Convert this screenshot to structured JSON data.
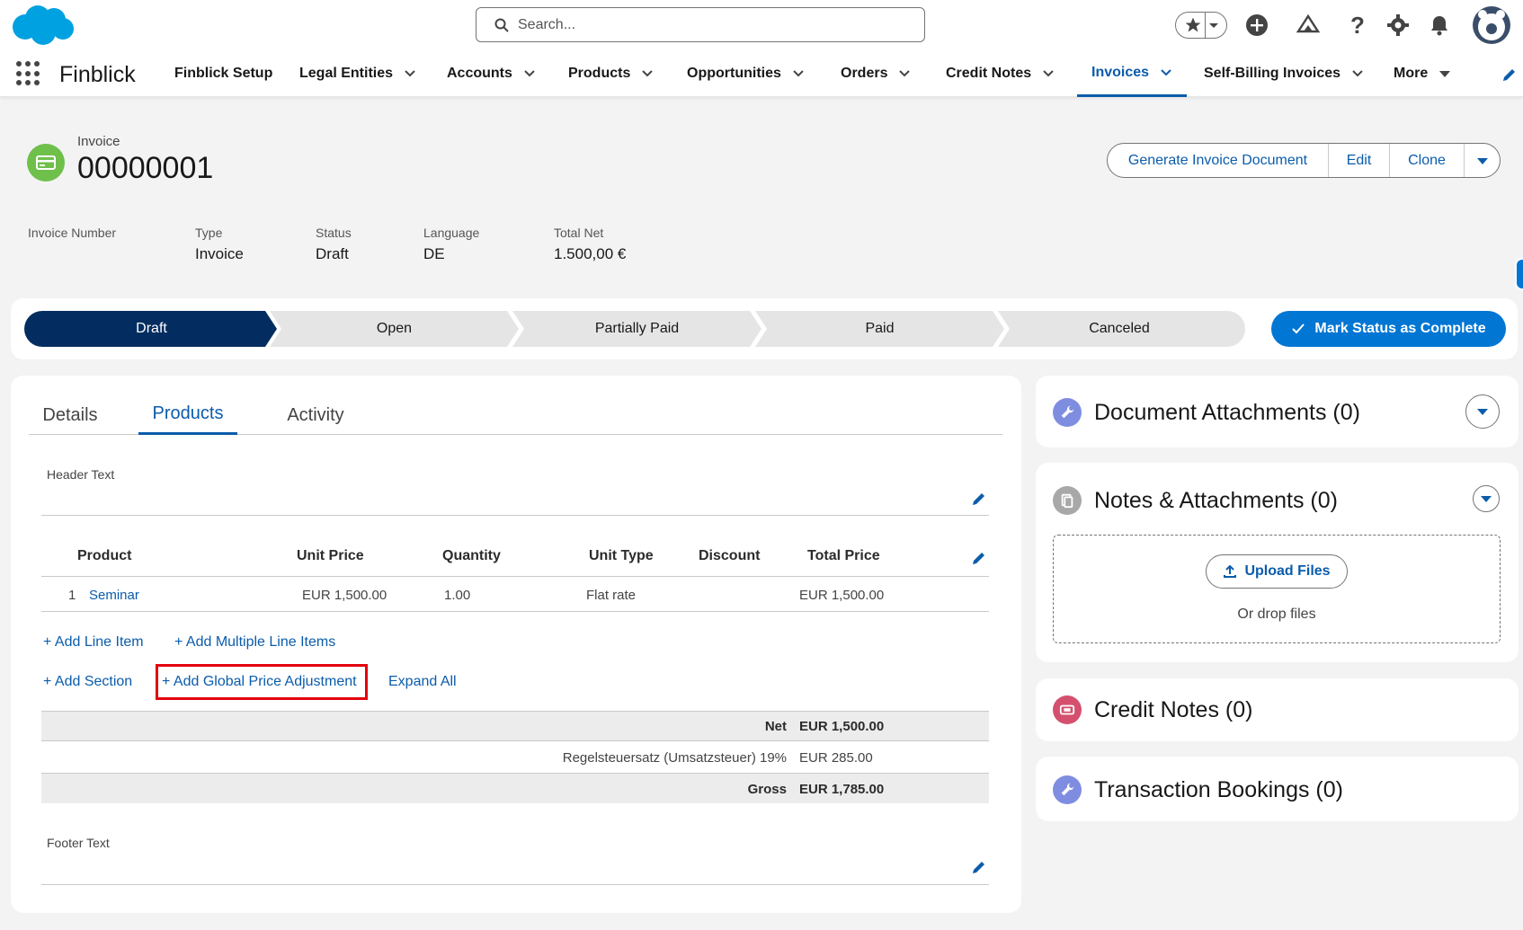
{
  "global": {
    "search_placeholder": "Search...",
    "app_name": "Finblick",
    "icons": [
      "cloud-logo-icon",
      "star-icon",
      "chevron-down-icon",
      "plus-icon",
      "trailhead-icon",
      "help-icon",
      "gear-icon",
      "bell-icon",
      "avatar-icon",
      "app-launcher-icon",
      "edit-nav-icon"
    ]
  },
  "nav": {
    "items": [
      {
        "label": "Finblick Setup",
        "has_menu": false,
        "active": false
      },
      {
        "label": "Legal Entities",
        "has_menu": true,
        "active": false
      },
      {
        "label": "Accounts",
        "has_menu": true,
        "active": false
      },
      {
        "label": "Products",
        "has_menu": true,
        "active": false
      },
      {
        "label": "Opportunities",
        "has_menu": true,
        "active": false
      },
      {
        "label": "Orders",
        "has_menu": true,
        "active": false
      },
      {
        "label": "Credit Notes",
        "has_menu": true,
        "active": false
      },
      {
        "label": "Invoices",
        "has_menu": true,
        "active": true
      },
      {
        "label": "Self-Billing Invoices",
        "has_menu": true,
        "active": false
      },
      {
        "label": "More",
        "has_menu": true,
        "active": false
      }
    ]
  },
  "record": {
    "type_label": "Invoice",
    "title": "00000001",
    "actions": {
      "generate": "Generate Invoice Document",
      "edit": "Edit",
      "clone": "Clone"
    },
    "fields": [
      {
        "label": "Invoice Number",
        "value": ""
      },
      {
        "label": "Type",
        "value": "Invoice"
      },
      {
        "label": "Status",
        "value": "Draft"
      },
      {
        "label": "Language",
        "value": "DE"
      },
      {
        "label": "Total Net",
        "value": "1.500,00 €"
      }
    ]
  },
  "path": {
    "steps": [
      "Draft",
      "Open",
      "Partially Paid",
      "Paid",
      "Canceled"
    ],
    "current": "Draft",
    "mark_button": "Mark Status as Complete"
  },
  "tabs": {
    "items": [
      "Details",
      "Products",
      "Activity"
    ],
    "active": "Products"
  },
  "products": {
    "header_text_label": "Header Text",
    "footer_text_label": "Footer Text",
    "columns": [
      "Product",
      "Unit Price",
      "Quantity",
      "Unit Type",
      "Discount",
      "Total Price"
    ],
    "rows": [
      {
        "index": "1",
        "product": "Seminar",
        "unit_price": "EUR 1,500.00",
        "quantity": "1.00",
        "unit_type": "Flat rate",
        "discount": "",
        "total_price": "EUR 1,500.00"
      }
    ],
    "links": {
      "add_line_item": "+ Add Line Item",
      "add_multiple": "+ Add Multiple Line Items",
      "add_section": "+ Add Section",
      "add_global_adj": "+ Add Global Price Adjustment",
      "expand_all": "Expand All"
    },
    "summary": {
      "net_label": "Net",
      "net_value": "EUR 1,500.00",
      "tax_label": "Regelsteuersatz (Umsatzsteuer) 19%",
      "tax_value": "EUR 285.00",
      "gross_label": "Gross",
      "gross_value": "EUR 1,785.00"
    }
  },
  "related": {
    "doc_attachments": "Document Attachments (0)",
    "notes_attachments": "Notes & Attachments (0)",
    "upload_button": "Upload Files",
    "drop_text": "Or drop files",
    "credit_notes": "Credit Notes (0)",
    "transaction_bookings": "Transaction Bookings (0)"
  },
  "colors": {
    "brand_blue": "#0b5cab",
    "button_blue": "#0176d3",
    "path_current": "#032d60",
    "highlight_red": "#e3000f"
  }
}
